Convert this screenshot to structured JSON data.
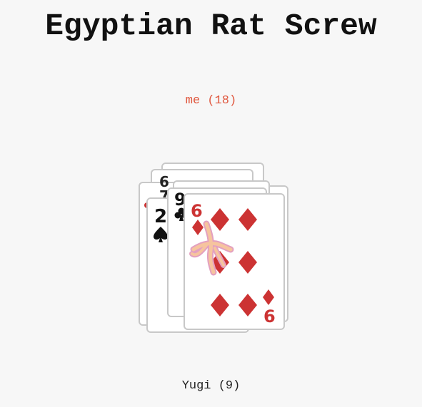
{
  "game": {
    "title": "Egyptian Rat Screw"
  },
  "players": {
    "top": {
      "label": "me (18)",
      "color": "#e0573e"
    },
    "bottom": {
      "label": "Yugi (9)",
      "color": "#222222"
    }
  },
  "pile": {
    "cards": [
      {
        "rank": "",
        "suit": "unknown",
        "color": "#222222"
      },
      {
        "rank": "6",
        "suit": "unknown",
        "color": "#222222"
      },
      {
        "rank": "",
        "suit": "unknown",
        "color": "#222222"
      },
      {
        "rank": "7",
        "suit": "unknown",
        "color": "#222222"
      },
      {
        "rank": "",
        "suit": "unknown",
        "color": "#cc3333"
      },
      {
        "rank": "2",
        "suit": "spades",
        "color": "#111111"
      },
      {
        "rank": "9",
        "suit": "clubs",
        "color": "#111111"
      },
      {
        "rank": "6",
        "suit": "diamonds",
        "color": "#cc3333"
      }
    ],
    "top_card": {
      "rank": "6",
      "suit": "diamonds",
      "color": "#cc3333",
      "corner_suit_icon": "diamond-icon"
    },
    "slap_mark_icon": "slap-hand-icon",
    "slap_color": "#f3a38a"
  }
}
